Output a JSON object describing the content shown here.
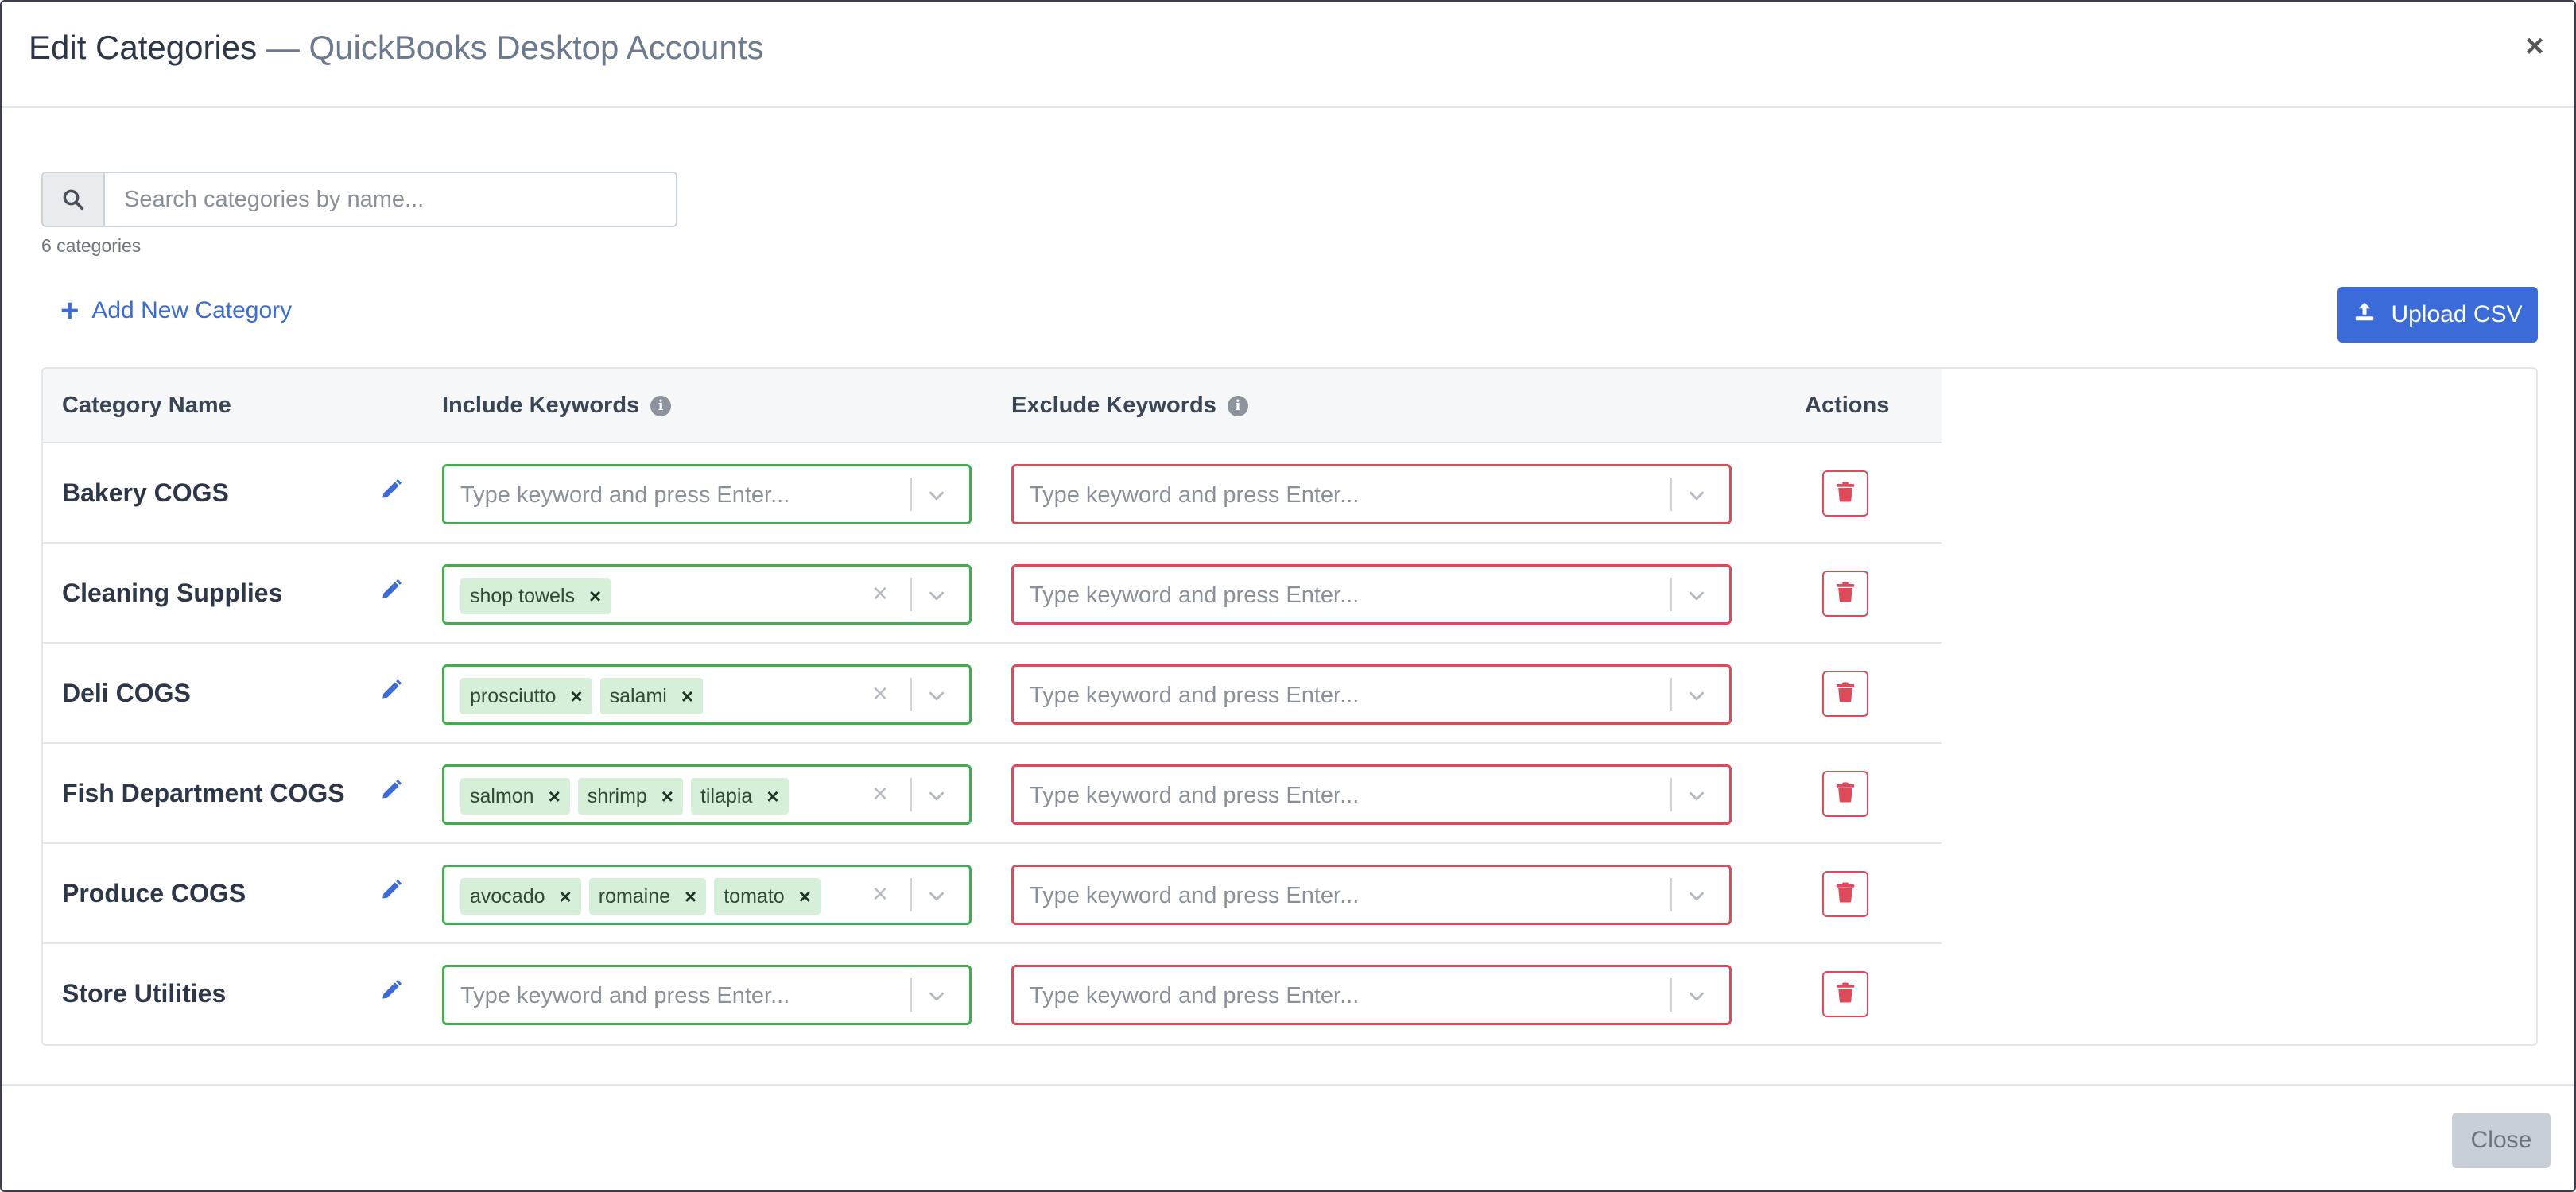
{
  "modal": {
    "title": "Edit Categories",
    "title_sep": "—",
    "subtitle": "QuickBooks Desktop Accounts",
    "close_icon": "close-icon"
  },
  "search": {
    "placeholder": "Search categories by name...",
    "icon": "search-icon",
    "count_text": "6 categories"
  },
  "toolbar": {
    "add_label": "Add New Category",
    "upload_label": "Upload CSV",
    "accent_color": "#3a6bd8"
  },
  "table": {
    "headers": {
      "name": "Category Name",
      "include": "Include Keywords",
      "exclude": "Exclude Keywords",
      "actions": "Actions"
    },
    "keyword_placeholder": "Type keyword and press Enter...",
    "include_color": "#3fae4c",
    "exclude_color": "#e0495a",
    "rows": [
      {
        "name": "Bakery COGS",
        "include": [],
        "exclude": []
      },
      {
        "name": "Cleaning Supplies",
        "include": [
          "shop towels"
        ],
        "exclude": []
      },
      {
        "name": "Deli COGS",
        "include": [
          "prosciutto",
          "salami"
        ],
        "exclude": []
      },
      {
        "name": "Fish Department COGS",
        "include": [
          "salmon",
          "shrimp",
          "tilapia"
        ],
        "exclude": []
      },
      {
        "name": "Produce COGS",
        "include": [
          "avocado",
          "romaine",
          "tomato"
        ],
        "exclude": []
      },
      {
        "name": "Store Utilities",
        "include": [],
        "exclude": []
      }
    ]
  },
  "footer": {
    "close_label": "Close"
  }
}
